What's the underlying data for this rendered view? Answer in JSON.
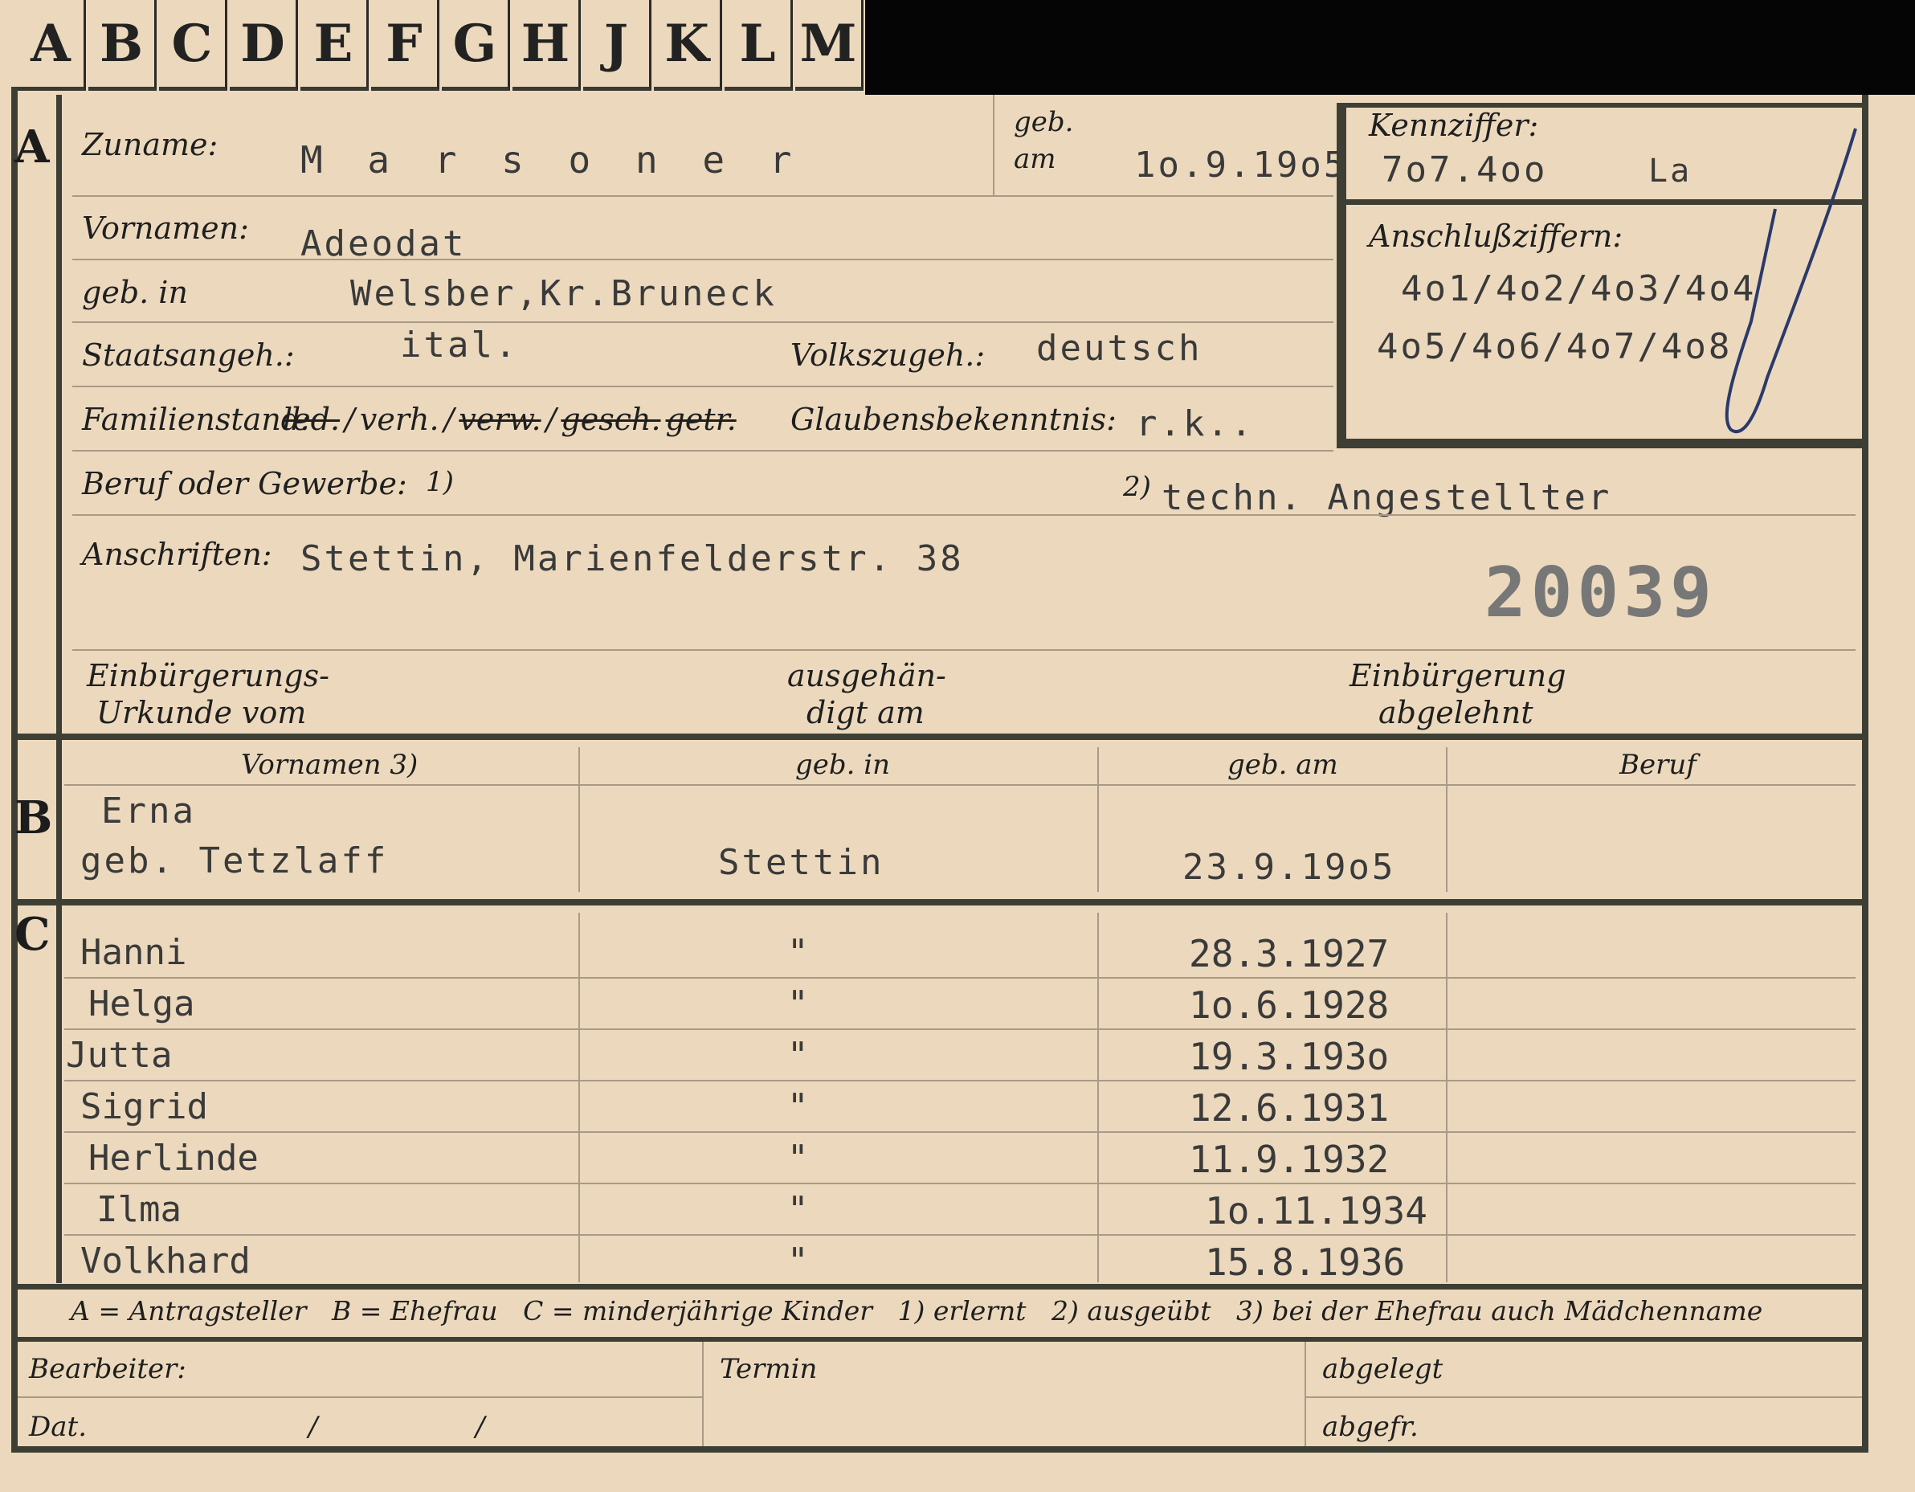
{
  "tabs": [
    "A",
    "B",
    "C",
    "D",
    "E",
    "F",
    "G",
    "H",
    "J",
    "K",
    "L",
    "M"
  ],
  "sections": {
    "a": "A",
    "b": "B",
    "c": "C"
  },
  "person": {
    "surname_label": "Zuname:",
    "surname": "M a r s o n e r",
    "birth_label_1": "geb.",
    "birth_label_2": "am",
    "birth_date": "1o.9.19o5",
    "first_names_label": "Vornamen:",
    "first_names": "Adeodat",
    "birthplace_label": "geb. in",
    "birthplace": "Welsber,Kr.Bruneck",
    "citizenship_label": "Staatsangeh.:",
    "citizenship": "ital.",
    "ethnicity_label": "Volkszugeh.:",
    "ethnicity": "deutsch",
    "family_status_label": "Familienstand:",
    "family_status_options": [
      "led.",
      "verh.",
      "verw.",
      "gesch.",
      "getr."
    ],
    "family_status_sep": "/",
    "religion_label": "Glaubensbekenntnis:",
    "religion": "r.k..",
    "occupation_label": "Beruf oder Gewerbe:",
    "occupation_note1": "1)",
    "occupation_note2": "2)",
    "occupation": "techn. Angestellter",
    "address_label": "Anschriften:",
    "address": "Stettin, Marienfelderstr. 38",
    "stamp_number": "20039"
  },
  "id_box": {
    "code_label": "Kennziffer:",
    "code": "7o7.4oo",
    "code_suffix": "La",
    "linked_label": "Anschlußziffern:",
    "linked_line1": "4o1/4o2/4o3/4o4",
    "linked_line2": "4o5/4o6/4o7/4o8"
  },
  "naturalization": {
    "certificate_label_1": "Einbürgerungs-",
    "certificate_label_2": "Urkunde vom",
    "handed_label_1": "ausgehän-",
    "handed_label_2": "digt am",
    "refused_label_1": "Einbürgerung",
    "refused_label_2": "abgelehnt"
  },
  "spouse": {
    "col_first_names": "Vornamen 3)",
    "col_birthplace": "geb. in",
    "col_birthdate": "geb. am",
    "col_occupation": "Beruf",
    "first_name": "Erna",
    "maiden_name": "geb. Tetzlaff",
    "birthplace": "Stettin",
    "birthdate": "23.9.19o5"
  },
  "children": [
    {
      "name": "Hanni",
      "place": "\"",
      "date": "28.3.1927"
    },
    {
      "name": "Helga",
      "place": "\"",
      "date": "1o.6.1928"
    },
    {
      "name": "Jutta",
      "place": "\"",
      "date": "19.3.193o"
    },
    {
      "name": "Sigrid",
      "place": "\"",
      "date": "12.6.1931"
    },
    {
      "name": "Herlinde",
      "place": "\"",
      "date": "11.9.1932"
    },
    {
      "name": "Ilma",
      "place": "\"",
      "date": "1o.11.1934"
    },
    {
      "name": "Volkhard",
      "place": "\"",
      "date": "15.8.1936"
    }
  ],
  "legend": "A = Antragsteller   B = Ehefrau   C = minderjährige Kinder   1) erlernt   2) ausgeübt   3) bei der Ehefrau auch Mädchenname",
  "footer": {
    "clerk_label": "Bearbeiter:",
    "date_label": "Dat.",
    "slash": "/",
    "deadline_label": "Termin",
    "filed_label": "abgelegt",
    "sent_label": "abgefr."
  },
  "colors": {
    "paper": "#ecd9bd",
    "border": "#3d3f34",
    "ink": "#3a3a3a"
  }
}
